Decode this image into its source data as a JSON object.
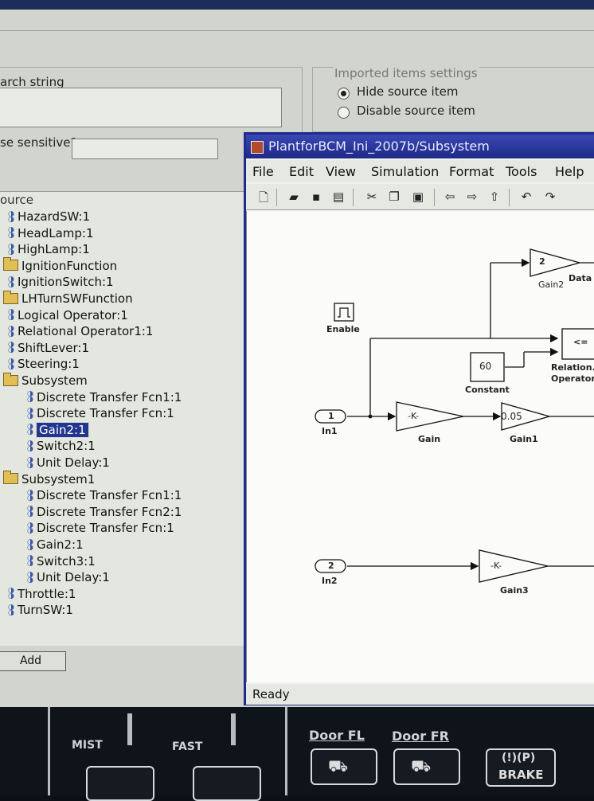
{
  "dialog": {
    "search_label": "arch string",
    "case_label": "se sensitive?",
    "imported_group_label": "Imported items settings",
    "radio_hide": "Hide source item",
    "radio_disable": "Disable source item",
    "tree_header": "ource",
    "add_button": "Add"
  },
  "tree": [
    {
      "label": "HazardSW:1",
      "type": "signal"
    },
    {
      "label": "HeadLamp:1",
      "type": "signal"
    },
    {
      "label": "HighLamp:1",
      "type": "signal"
    },
    {
      "label": "IgnitionFunction",
      "type": "folder"
    },
    {
      "label": "IgnitionSwitch:1",
      "type": "signal"
    },
    {
      "label": "LHTurnSWFunction",
      "type": "folder"
    },
    {
      "label": "Logical Operator:1",
      "type": "signal"
    },
    {
      "label": "Relational Operator1:1",
      "type": "signal"
    },
    {
      "label": "ShiftLever:1",
      "type": "signal"
    },
    {
      "label": "Steering:1",
      "type": "signal"
    },
    {
      "label": "Subsystem",
      "type": "folder"
    },
    {
      "label": "Discrete Transfer Fcn1:1",
      "type": "signal"
    },
    {
      "label": "Discrete Transfer Fcn:1",
      "type": "signal"
    },
    {
      "label": "Gain2:1",
      "type": "signal",
      "selected": true
    },
    {
      "label": "Switch2:1",
      "type": "signal"
    },
    {
      "label": "Unit Delay:1",
      "type": "signal"
    },
    {
      "label": "Subsystem1",
      "type": "folder"
    },
    {
      "label": "Discrete Transfer Fcn1:1",
      "type": "signal"
    },
    {
      "label": "Discrete Transfer Fcn2:1",
      "type": "signal"
    },
    {
      "label": "Discrete Transfer Fcn:1",
      "type": "signal"
    },
    {
      "label": "Gain2:1",
      "type": "signal"
    },
    {
      "label": "Switch3:1",
      "type": "signal"
    },
    {
      "label": "Unit Delay:1",
      "type": "signal"
    },
    {
      "label": "Throttle:1",
      "type": "signal"
    },
    {
      "label": "TurnSW:1",
      "type": "signal"
    }
  ],
  "simulink": {
    "title": "PlantforBCM_Ini_2007b/Subsystem",
    "menus": [
      "File",
      "Edit",
      "View",
      "Simulation",
      "Format",
      "Tools",
      "Help"
    ],
    "status": "Ready",
    "blocks": {
      "gain2_value": "2",
      "gain2_label": "Gain2",
      "data_label": "Data",
      "enable_label": "Enable",
      "relational_value": "<=",
      "relational_label_1": "Relation.",
      "relational_label_2": "Operator",
      "constant_value": "60",
      "constant_label": "Constant",
      "in1_value": "1",
      "in1_label": "In1",
      "gain_value": "-K-",
      "gain_label": "Gain",
      "gain1_value": "0.05",
      "gain1_label": "Gain1",
      "in2_value": "2",
      "in2_label": "In2",
      "gain3_value": "-K-",
      "gain3_label": "Gain3"
    }
  },
  "panel": {
    "mist": "MIST",
    "fast": "FAST",
    "door_fl": "Door FL",
    "door_fr": "Door FR",
    "brake": "BRAKE"
  },
  "colors": {
    "title_bar": "#1f2c8c",
    "selection": "#22358f",
    "panel_bg": "#0f131a"
  }
}
